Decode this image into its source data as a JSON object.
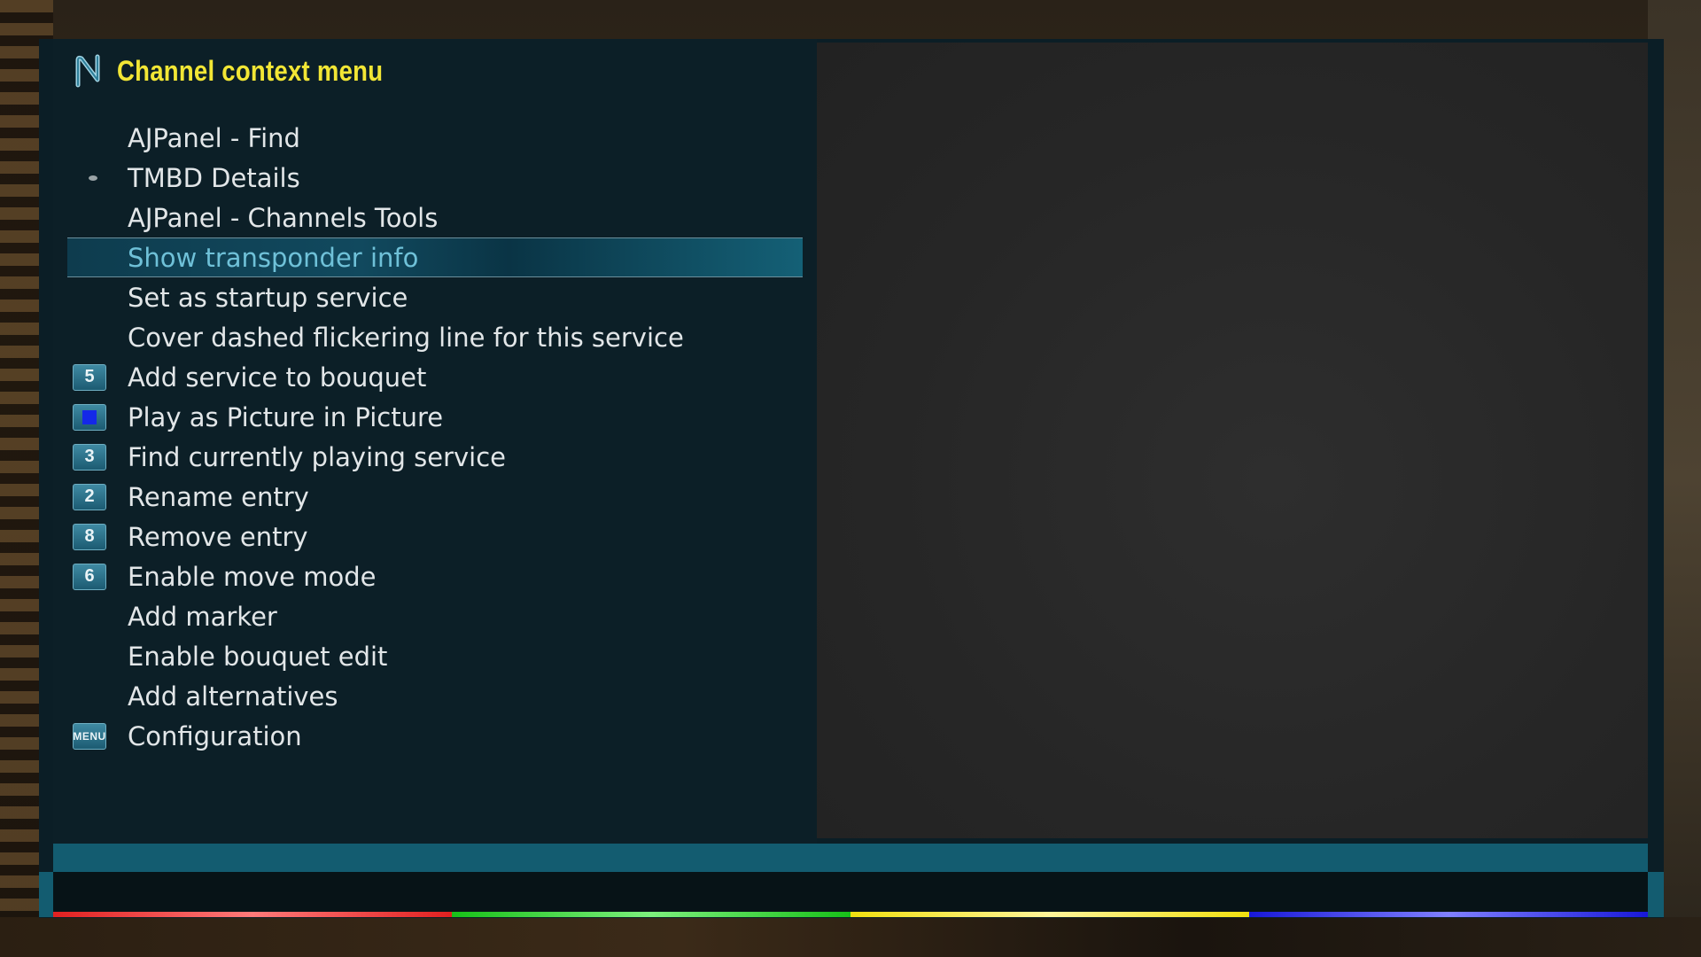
{
  "window": {
    "title": "Channel context menu"
  },
  "menu": {
    "items": [
      {
        "label": "AJPanel - Find",
        "key": "",
        "icon": "none"
      },
      {
        "label": "TMBD Details",
        "key": "",
        "icon": "dot-icon"
      },
      {
        "label": "AJPanel - Channels Tools",
        "key": "",
        "icon": "none"
      },
      {
        "label": "Show transponder info",
        "key": "",
        "icon": "none",
        "selected": true
      },
      {
        "label": "Set as startup service",
        "key": "",
        "icon": "none"
      },
      {
        "label": "Cover dashed flickering line for this service",
        "key": "",
        "icon": "none"
      },
      {
        "label": "Add service to bouquet",
        "key": "5",
        "icon": "key-5-icon"
      },
      {
        "label": "Play as Picture in Picture",
        "key": "",
        "icon": "blue-key-icon"
      },
      {
        "label": "Find currently playing service",
        "key": "3",
        "icon": "key-3-icon"
      },
      {
        "label": "Rename entry",
        "key": "2",
        "icon": "key-2-icon"
      },
      {
        "label": "Remove entry",
        "key": "8",
        "icon": "key-8-icon"
      },
      {
        "label": "Enable move mode",
        "key": "6",
        "icon": "key-6-icon"
      },
      {
        "label": "Add marker",
        "key": "",
        "icon": "none"
      },
      {
        "label": "Enable bouquet edit",
        "key": "",
        "icon": "none"
      },
      {
        "label": "Add alternatives",
        "key": "",
        "icon": "none"
      },
      {
        "label": "Configuration",
        "key": "MENU",
        "icon": "menu-key-icon"
      }
    ]
  },
  "colors": {
    "title": "#f2e635",
    "selected_text": "#6fc1d8",
    "text": "#e2e6e8",
    "accent": "#135c70",
    "key_red": "#e02020",
    "key_green": "#18c018",
    "key_yellow": "#f0e010",
    "key_blue": "#1818d8"
  }
}
